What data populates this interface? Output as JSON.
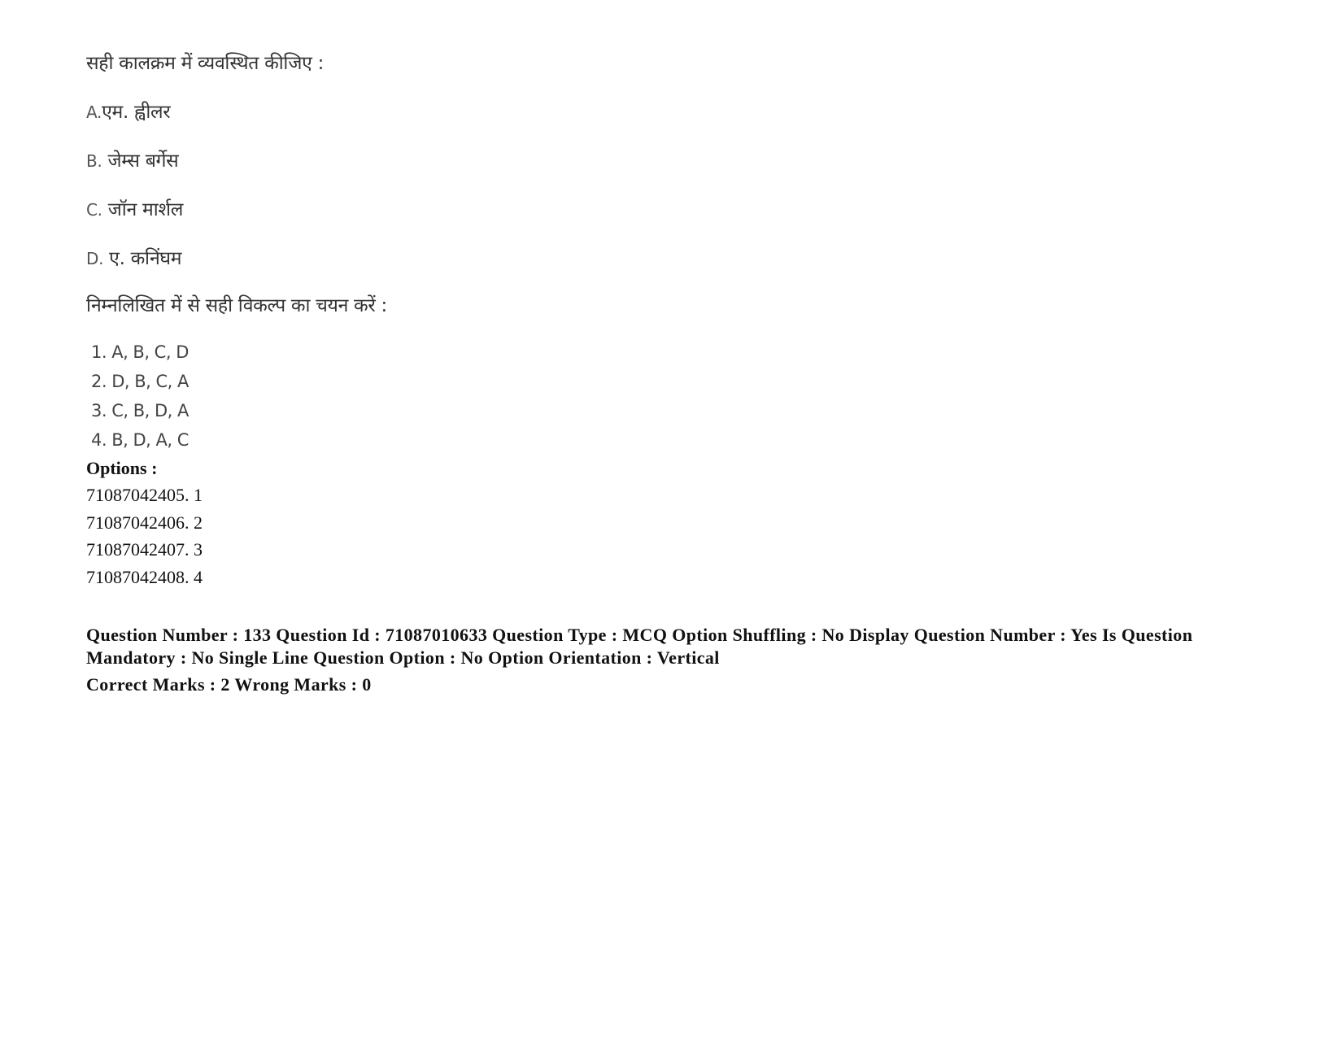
{
  "question": {
    "instruction": "सही कालक्रम में व्यवस्थित कीजिए :",
    "items": [
      {
        "label": "A.",
        "text": "एम. ह्वीलर"
      },
      {
        "label": "B.",
        "text": " जेम्स बर्गेस"
      },
      {
        "label": "C.",
        "text": " जॉन मार्शल"
      },
      {
        "label": "D.",
        "text": " ए. कनिंघम"
      }
    ],
    "prompt": "निम्नलिखित में से सही विकल्प का चयन करें :",
    "choices": [
      "1. A, B, C, D",
      "2. D, B, C, A",
      "3. C, B, D, A",
      "4. B, D, A, C"
    ]
  },
  "options": {
    "heading": "Options :",
    "list": [
      "71087042405. 1",
      "71087042406. 2",
      "71087042407. 3",
      "71087042408. 4"
    ]
  },
  "next_question_meta": {
    "line1": "Question Number : 133 Question Id : 71087010633 Question Type : MCQ Option Shuffling : No Display Question Number : Yes Is Question Mandatory : No Single Line Question Option : No Option Orientation : Vertical",
    "line2": "Correct Marks : 2 Wrong Marks : 0"
  }
}
